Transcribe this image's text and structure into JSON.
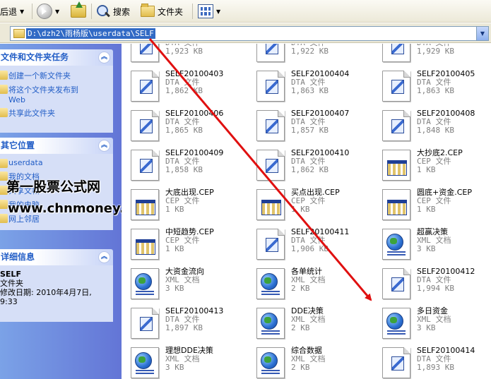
{
  "toolbar": {
    "back_label": "后退",
    "search_label": "搜索",
    "folders_label": "文件夹"
  },
  "address": {
    "path": "D:\\dzh2\\雨杨版\\userdata\\SELF"
  },
  "left_pane": {
    "tasks": {
      "title": "文件和文件夹任务",
      "items": [
        {
          "label": "创建一个新文件夹"
        },
        {
          "label": "将这个文件夹发布到 Web"
        },
        {
          "label": "共享此文件夹"
        }
      ]
    },
    "places": {
      "title": "其它位置",
      "items": [
        {
          "label": "userdata"
        },
        {
          "label": "我的文档"
        },
        {
          "label": "共享文档"
        },
        {
          "label": "我的电脑"
        },
        {
          "label": "网上邻居"
        }
      ]
    },
    "details": {
      "title": "详细信息",
      "name": "SELF",
      "type": "文件夹",
      "modified": "修改日期: 2010年4月7日, 9:33"
    }
  },
  "watermark": {
    "line1": "第一股票公式网",
    "line2": "www.chnmoney.com"
  },
  "files": [
    {
      "name": "",
      "type": "DTA 文件",
      "size": "1,923 KB",
      "kind": "dta"
    },
    {
      "name": "",
      "type": "DTA 文件",
      "size": "1,922 KB",
      "kind": "dta"
    },
    {
      "name": "",
      "type": "DTA 文件",
      "size": "1,929 KB",
      "kind": "dta"
    },
    {
      "name": "SELF20100403",
      "type": "DTA 文件",
      "size": "1,862 KB",
      "kind": "dta"
    },
    {
      "name": "SELF20100404",
      "type": "DTA 文件",
      "size": "1,863 KB",
      "kind": "dta"
    },
    {
      "name": "SELF20100405",
      "type": "DTA 文件",
      "size": "1,863 KB",
      "kind": "dta"
    },
    {
      "name": "SELF20100406",
      "type": "DTA 文件",
      "size": "1,865 KB",
      "kind": "dta"
    },
    {
      "name": "SELF20100407",
      "type": "DTA 文件",
      "size": "1,857 KB",
      "kind": "dta"
    },
    {
      "name": "SELF20100408",
      "type": "DTA 文件",
      "size": "1,848 KB",
      "kind": "dta"
    },
    {
      "name": "SELF20100409",
      "type": "DTA 文件",
      "size": "1,858 KB",
      "kind": "dta"
    },
    {
      "name": "SELF20100410",
      "type": "DTA 文件",
      "size": "1,862 KB",
      "kind": "dta"
    },
    {
      "name": "大抄底2.CEP",
      "type": "CEP 文件",
      "size": "1 KB",
      "kind": "cep"
    },
    {
      "name": "大底出现.CEP",
      "type": "CEP 文件",
      "size": "1 KB",
      "kind": "cep"
    },
    {
      "name": "买点出现.CEP",
      "type": "CEP 文件",
      "size": "1 KB",
      "kind": "cep"
    },
    {
      "name": "圆底+资金.CEP",
      "type": "CEP 文件",
      "size": "1 KB",
      "kind": "cep"
    },
    {
      "name": "中短趋势.CEP",
      "type": "CEP 文件",
      "size": "1 KB",
      "kind": "cep"
    },
    {
      "name": "SELF20100411",
      "type": "DTA 文件",
      "size": "1,906 KB",
      "kind": "dta"
    },
    {
      "name": "超赢决策",
      "type": "XML 文档",
      "size": "3 KB",
      "kind": "xml"
    },
    {
      "name": "大资金流向",
      "type": "XML 文档",
      "size": "3 KB",
      "kind": "xml"
    },
    {
      "name": "各单统计",
      "type": "XML 文档",
      "size": "2 KB",
      "kind": "xml"
    },
    {
      "name": "SELF20100412",
      "type": "DTA 文件",
      "size": "1,994 KB",
      "kind": "dta"
    },
    {
      "name": "SELF20100413",
      "type": "DTA 文件",
      "size": "1,897 KB",
      "kind": "dta"
    },
    {
      "name": "DDE决策",
      "type": "XML 文档",
      "size": "2 KB",
      "kind": "xml"
    },
    {
      "name": "多日资金",
      "type": "XML 文档",
      "size": "3 KB",
      "kind": "xml"
    },
    {
      "name": "理想DDE决策",
      "type": "XML 文档",
      "size": "3 KB",
      "kind": "xml"
    },
    {
      "name": "综合数据",
      "type": "XML 文档",
      "size": "2 KB",
      "kind": "xml"
    },
    {
      "name": "SELF20100414",
      "type": "DTA 文件",
      "size": "1,893 KB",
      "kind": "dta"
    }
  ],
  "colors": {
    "arrow": "#e01010",
    "selection": "#316ac5",
    "task_link": "#215dc6"
  }
}
